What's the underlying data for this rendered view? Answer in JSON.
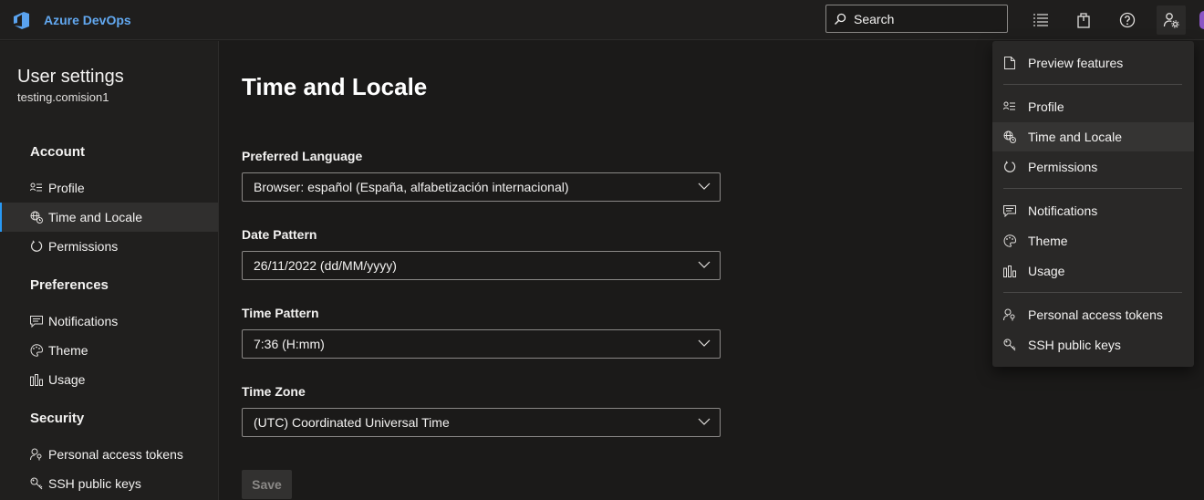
{
  "topbar": {
    "brand": "Azure DevOps",
    "search_placeholder": "Search",
    "icons": [
      "list-settings-icon",
      "marketplace-bag-icon",
      "help-icon",
      "user-settings-icon"
    ]
  },
  "sidebar": {
    "title": "User settings",
    "user": "testing.comision1",
    "sections": {
      "account": "Account",
      "preferences": "Preferences",
      "security": "Security"
    },
    "items": {
      "profile": "Profile",
      "time_locale": "Time and Locale",
      "permissions": "Permissions",
      "notifications": "Notifications",
      "theme": "Theme",
      "usage": "Usage",
      "pat": "Personal access tokens",
      "ssh": "SSH public keys"
    },
    "selected": "Time and Locale"
  },
  "main": {
    "title": "Time and Locale",
    "fields": {
      "language": {
        "label": "Preferred Language",
        "value": "Browser: español (España, alfabetización internacional)"
      },
      "date": {
        "label": "Date Pattern",
        "value": "26/11/2022 (dd/MM/yyyy)"
      },
      "time": {
        "label": "Time Pattern",
        "value": "7:36 (H:mm)"
      },
      "zone": {
        "label": "Time Zone",
        "value": "(UTC) Coordinated Universal Time"
      }
    },
    "save_label": "Save"
  },
  "menu": {
    "preview": "Preview features",
    "profile": "Profile",
    "time_locale": "Time and Locale",
    "permissions": "Permissions",
    "notifications": "Notifications",
    "theme": "Theme",
    "usage": "Usage",
    "pat": "Personal access tokens",
    "ssh": "SSH public keys"
  },
  "colors": {
    "brand": "#62a8f0",
    "selection_accent": "#2899f5",
    "background": "#1b1a19"
  }
}
